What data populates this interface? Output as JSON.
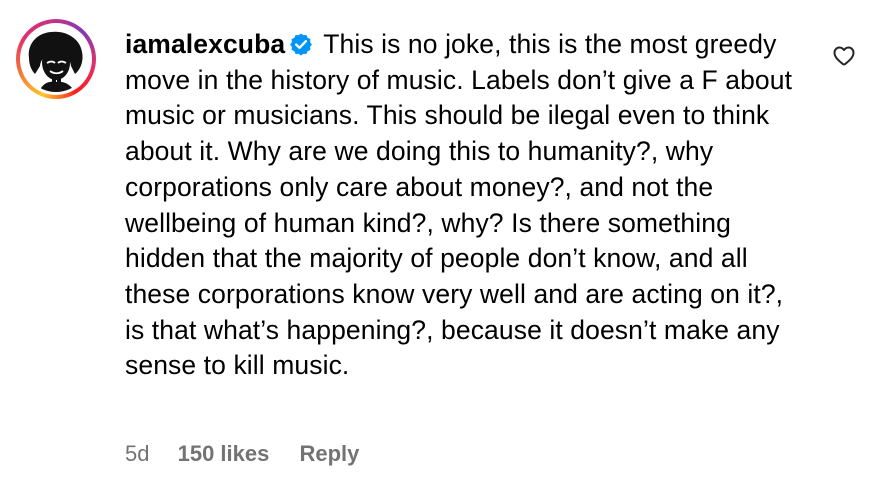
{
  "comment": {
    "username": "iamalexcuba",
    "verified_icon": "verified-badge-icon",
    "text": "This is no joke, this is the most greedy move in the history of music. Labels don’t give a F about music or musicians. This should be ilegal even to think about it. Why are we doing this to humanity?, why corporations only care about money?, and not the wellbeing of human kind?, why? Is there something hidden that the majority of people don’t know, and all these corporations know very well and are acting on it?, is that what’s happening?, because it doesn’t make any sense to kill music.",
    "timestamp": "5d",
    "likes": "150 likes",
    "reply_label": "Reply",
    "like_icon": "heart-outline-icon"
  },
  "colors": {
    "verified": "#0095f6",
    "meta_text": "#737373",
    "text": "#000000"
  }
}
